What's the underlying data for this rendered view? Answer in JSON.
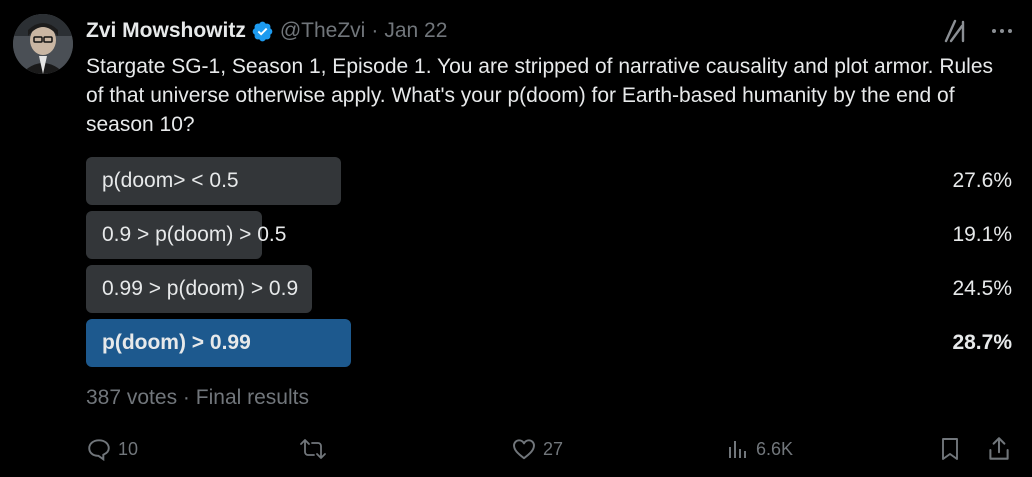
{
  "author": {
    "display_name": "Zvi Mowshowitz",
    "handle": "@TheZvi",
    "separator": "·",
    "date": "Jan 22",
    "verified": true
  },
  "icons": {
    "verified": "verified-badge-icon",
    "grok": "grok-icon",
    "more": "more-icon",
    "reply": "reply-icon",
    "retweet": "retweet-icon",
    "like": "like-icon",
    "views": "views-icon",
    "bookmark": "bookmark-icon",
    "share": "share-icon"
  },
  "colors": {
    "background": "#000000",
    "text": "#e7e9ea",
    "muted": "#71767b",
    "poll_bar": "#333639",
    "poll_winner": "#1d598e",
    "verified": "#1d9bf0"
  },
  "tweet": {
    "text": "Stargate SG-1, Season 1, Episode 1. You are stripped of narrative causality and plot armor. Rules of that universe otherwise apply. What's your p(doom) for Earth-based humanity by the end of season 10?"
  },
  "poll": {
    "options": [
      {
        "label": "p(doom> < 0.5",
        "percent_text": "27.6%",
        "percent": 27.6,
        "winner": false
      },
      {
        "label": "0.9 > p(doom) > 0.5",
        "percent_text": "19.1%",
        "percent": 19.1,
        "winner": false
      },
      {
        "label": "0.99 > p(doom) > 0.9",
        "percent_text": "24.5%",
        "percent": 24.5,
        "winner": false
      },
      {
        "label": "p(doom) > 0.99",
        "percent_text": "28.7%",
        "percent": 28.7,
        "winner": true
      }
    ],
    "votes_text": "387 votes",
    "separator": "·",
    "status_text": "Final results"
  },
  "actions": {
    "replies": "10",
    "likes": "27",
    "views": "6.6K"
  }
}
